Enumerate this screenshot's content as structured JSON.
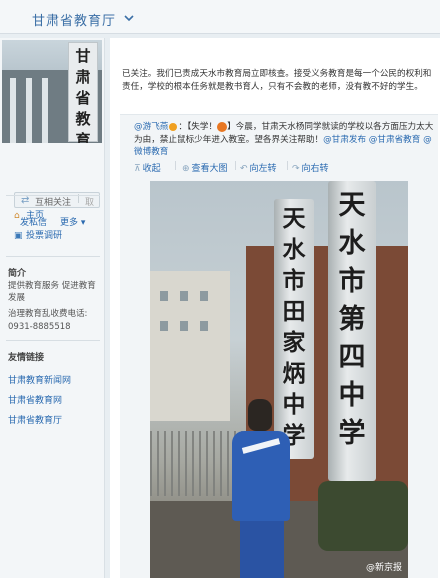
{
  "header": {
    "site_name": "甘肃省教育厅"
  },
  "sidebar": {
    "avatar_text": [
      "甘",
      "肃",
      "省",
      "教",
      "育"
    ],
    "follow_button": {
      "label": "互相关注",
      "separator": "|",
      "secondary": "取"
    },
    "dm_label": "发私信",
    "more_label": "更多",
    "nav": [
      {
        "icon": "home-icon",
        "label": "主页"
      },
      {
        "icon": "poll-icon",
        "label": "投票调研"
      }
    ],
    "intro": {
      "title": "简介",
      "text": "提供教育服务 促进教育发展",
      "hotline_label": "治理教育乱收费电话:",
      "hotline": "0931-8885518"
    },
    "links": {
      "title": "友情链接",
      "items": [
        "甘肃教育新闻网",
        "甘肃省教育网",
        "甘肃省教育厅"
      ]
    }
  },
  "post": {
    "text": "已关注。我们已责成天水市教育局立即核查。接受义务教育是每一个公民的权利和责任，学校的根本任务就是教书育人，只有不会教的老师，没有教不好的学生。",
    "repost": {
      "user": "@游飞燕",
      "tag": "【失学！",
      "body": "】今晨，甘肃天水杨同学就读的学校以各方面压力太大为由，禁止鼠标少年进入教室。望各界关注帮助！",
      "mentions": [
        "@甘肃发布",
        "@甘肃省教育",
        "@微博教育"
      ]
    },
    "actions": [
      {
        "icon": "collapse-icon",
        "label": "收起"
      },
      {
        "icon": "zoom-icon",
        "label": "查看大图"
      },
      {
        "icon": "rotate-left-icon",
        "label": "向左转"
      },
      {
        "icon": "rotate-right-icon",
        "label": "向右转"
      }
    ],
    "photo": {
      "sign_left": [
        "天",
        "水",
        "市",
        "田",
        "家",
        "炳",
        "中",
        "学"
      ],
      "sign_right": [
        "天",
        "水",
        "市",
        "第",
        "四",
        "中",
        "学"
      ],
      "watermark": "@新京报"
    }
  }
}
